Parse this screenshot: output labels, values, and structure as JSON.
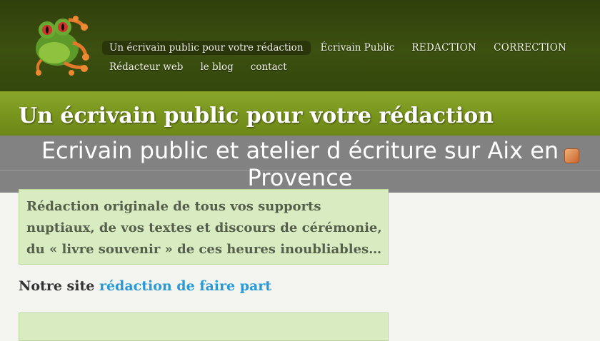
{
  "header": {
    "logo_icon": "frog-logo-icon",
    "nav_row1": [
      {
        "label": "Un écrivain public pour votre rédaction",
        "active": true
      },
      {
        "label": "Écrivain Public"
      },
      {
        "label": "REDACTION"
      },
      {
        "label": "CORRECTION"
      }
    ],
    "nav_row2": [
      {
        "label": "Rédacteur web"
      },
      {
        "label": "le blog"
      },
      {
        "label": "contact"
      }
    ]
  },
  "banner": {
    "title": "Un écrivain public pour votre rédaction"
  },
  "overlay": {
    "title": "Ecrivain public et atelier d écriture sur Aix en Provence"
  },
  "feed": {
    "icon": "rss-icon"
  },
  "main": {
    "intro": "Rédaction originale de tous vos supports nuptiaux, de vos textes et discours de cérémonie, du « livre souvenir » de ces heures inoubliables…",
    "site_prefix": "Notre site",
    "site_link": "rédaction de faire part"
  },
  "colors": {
    "header_bg": "#3c5010",
    "banner_bg": "#7a961e",
    "box_bg": "#d9ecc1",
    "link": "#2a9ad6"
  }
}
